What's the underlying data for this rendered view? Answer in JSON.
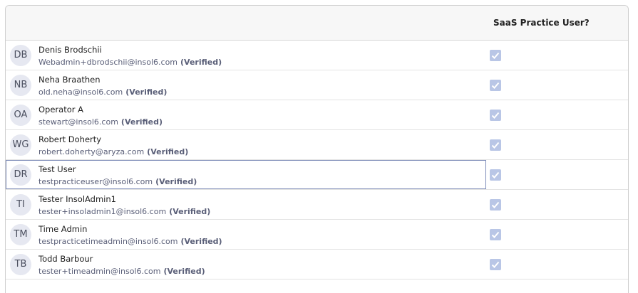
{
  "table": {
    "column_header": "SaaS Practice User?",
    "verified_label": "(Verified)",
    "rows": [
      {
        "initials": "DB",
        "name": "Denis Brodschii",
        "email": "Webadmin+dbrodschii@insol6.com",
        "saas_practice_user": true
      },
      {
        "initials": "NB",
        "name": "Neha Braathen",
        "email": "old.neha@insol6.com",
        "saas_practice_user": true
      },
      {
        "initials": "OA",
        "name": "Operator A",
        "email": "stewart@insol6.com",
        "saas_practice_user": true
      },
      {
        "initials": "WG",
        "name": "Robert Doherty",
        "email": "robert.doherty@aryza.com",
        "saas_practice_user": true
      },
      {
        "initials": "DR",
        "name": "Test User",
        "email": "testpracticeuser@insol6.com",
        "saas_practice_user": true
      },
      {
        "initials": "TI",
        "name": "Tester InsolAdmin1",
        "email": "tester+insoladmin1@insol6.com",
        "saas_practice_user": true
      },
      {
        "initials": "TM",
        "name": "Time Admin",
        "email": "testpracticetimeadmin@insol6.com",
        "saas_practice_user": true
      },
      {
        "initials": "TB",
        "name": "Todd Barbour",
        "email": "tester+timeadmin@insol6.com",
        "saas_practice_user": true
      }
    ]
  },
  "colors": {
    "checkbox_fill": "#b9c6e6",
    "avatar_bg": "#e6e8f1",
    "focus_border": "#7d8bb8"
  }
}
